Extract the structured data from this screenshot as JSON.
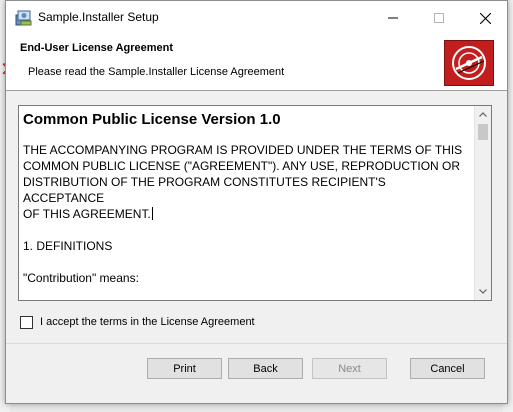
{
  "window": {
    "title": "Sample.Installer Setup",
    "app_icon": "installer-icon",
    "controls": [
      "minimize-icon",
      "maximize-icon",
      "close-icon"
    ]
  },
  "banner": {
    "title": "End-User License Agreement",
    "subtitle": "Please read the Sample.Installer License Agreement",
    "logo_icon": "disc-logo-icon",
    "logo_color": "#c21e1e"
  },
  "license": {
    "heading": "Common Public License Version 1.0",
    "paragraph1": "THE ACCOMPANYING PROGRAM IS PROVIDED UNDER THE TERMS OF THIS\nCOMMON PUBLIC LICENSE (\"AGREEMENT\"). ANY USE, REPRODUCTION OR\nDISTRIBUTION OF THE PROGRAM CONSTITUTES RECIPIENT'S ACCEPTANCE\nOF THIS AGREEMENT.",
    "section1": "1. DEFINITIONS",
    "contribution": "\"Contribution\" means:"
  },
  "accept": {
    "label": "I accept the terms in the License Agreement",
    "checked": false
  },
  "buttons": {
    "print": "Print",
    "back": "Back",
    "next": "Next",
    "cancel": "Cancel",
    "next_enabled": false
  }
}
